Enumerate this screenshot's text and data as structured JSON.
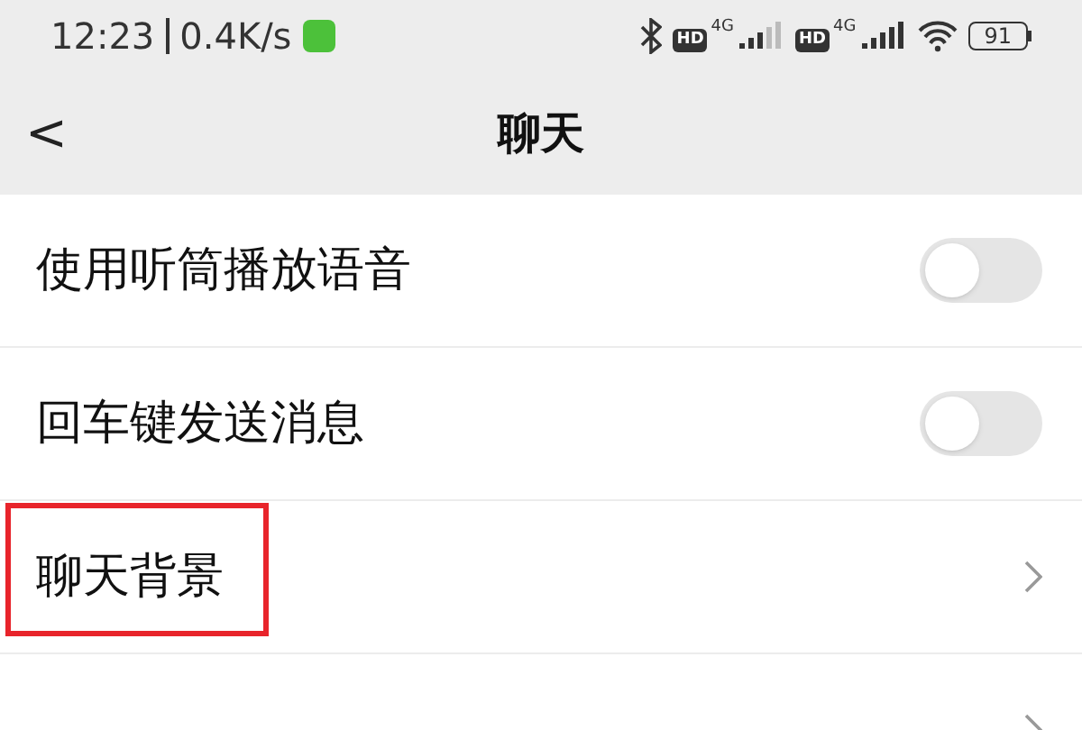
{
  "status_bar": {
    "time": "12:23",
    "speed": "0.4K/s",
    "badges": [
      {
        "hd": "HD",
        "network": "4G"
      },
      {
        "hd": "HD",
        "network": "4G"
      }
    ],
    "battery": "91"
  },
  "header": {
    "back": "<",
    "title": "聊天"
  },
  "settings": [
    {
      "label": "使用听筒播放语音",
      "kind": "toggle",
      "on": false,
      "highlighted": false
    },
    {
      "label": "回车键发送消息",
      "kind": "toggle",
      "on": false,
      "highlighted": false
    },
    {
      "label": "聊天背景",
      "kind": "link",
      "highlighted": true
    },
    {
      "kind": "link",
      "highlighted": false
    }
  ]
}
